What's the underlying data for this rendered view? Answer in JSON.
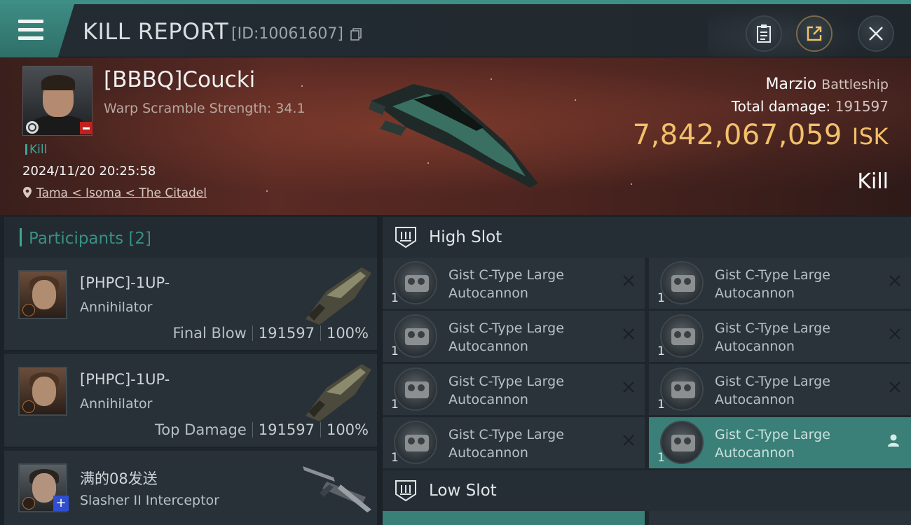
{
  "header": {
    "title": "KILL REPORT",
    "report_id": "[ID:10061607]"
  },
  "victim": {
    "name": "[BBBQ]Coucki",
    "warp_scramble": "Warp Scramble Strength: 34.1",
    "status": "Kill",
    "datetime": "2024/11/20 20:25:58",
    "location": "Tama < Isoma < The Citadel",
    "ship_name": "Marzio",
    "ship_class": "Battleship",
    "total_damage_label": "Total damage:",
    "total_damage_value": "191597",
    "isk_value": "7,842,067,059",
    "isk_unit": "ISK",
    "result": "Kill"
  },
  "participants": {
    "title": "Participants",
    "count": "[2]",
    "rows": [
      {
        "name": "[PHPC]-1UP-",
        "ship": "Annihilator",
        "role": "Final Blow",
        "damage": "191597",
        "percent": "100%"
      },
      {
        "name": "[PHPC]-1UP-",
        "ship": "Annihilator",
        "role": "Top Damage",
        "damage": "191597",
        "percent": "100%"
      },
      {
        "name": "满的08发送",
        "ship": "Slasher II Interceptor"
      }
    ]
  },
  "slots": {
    "high_title": "High Slot",
    "low_title": "Low Slot",
    "high_modules": [
      {
        "line1": "Gist C-Type Large",
        "line2": "Autocannon",
        "qty": "1"
      },
      {
        "line1": "Gist C-Type Large",
        "line2": "Autocannon",
        "qty": "1"
      },
      {
        "line1": "Gist C-Type Large",
        "line2": "Autocannon",
        "qty": "1"
      },
      {
        "line1": "Gist C-Type Large",
        "line2": "Autocannon",
        "qty": "1"
      },
      {
        "line1": "Gist C-Type Large",
        "line2": "Autocannon",
        "qty": "1"
      },
      {
        "line1": "Gist C-Type Large",
        "line2": "Autocannon",
        "qty": "1"
      },
      {
        "line1": "Gist C-Type Large",
        "line2": "Autocannon",
        "qty": "1"
      },
      {
        "line1": "Gist C-Type Large",
        "line2": "Autocannon",
        "qty": "1"
      }
    ]
  },
  "icons": {
    "menu": "hamburger-icon",
    "copy": "copy-icon",
    "clipboard": "clipboard-icon",
    "share": "share-icon",
    "close": "close-icon",
    "location": "location-pin-icon",
    "slot": "slot-icon",
    "remove": "x-icon",
    "person": "person-icon"
  },
  "colors": {
    "accent": "#3fa596",
    "isk": "#f2c06b",
    "selected": "#3a7f78"
  }
}
